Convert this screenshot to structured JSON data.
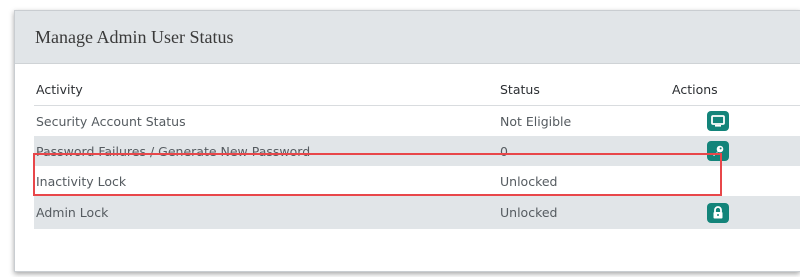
{
  "panel": {
    "title": "Manage Admin User Status"
  },
  "table": {
    "columns": {
      "activity": "Activity",
      "status": "Status",
      "actions": "Actions"
    },
    "rows": [
      {
        "activity": "Security Account Status",
        "status": "Not Eligible",
        "action_icon": "monitor-icon"
      },
      {
        "activity": "Password Failures / Generate New Password",
        "status": "0",
        "action_icon": "key-icon"
      },
      {
        "activity": "Inactivity Lock",
        "status": "Unlocked",
        "action_icon": ""
      },
      {
        "activity": "Admin Lock",
        "status": "Unlocked",
        "action_icon": "lock-icon"
      }
    ]
  },
  "colors": {
    "header_bg": "#e1e5e8",
    "action_button": "#13847a",
    "highlight": "#e8474a"
  }
}
